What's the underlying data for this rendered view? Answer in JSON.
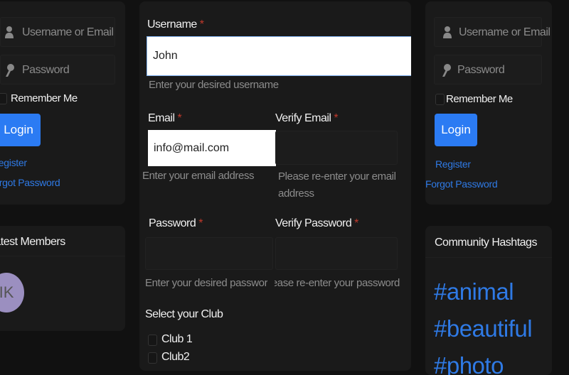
{
  "login_widget": {
    "username_placeholder": "Username or Email",
    "password_placeholder": "Password",
    "remember_label": "Remember Me",
    "login_button": "Login",
    "register_link": "Register",
    "forgot_link": "Forgot Password"
  },
  "latest_members": {
    "title": "Latest Members",
    "members": [
      {
        "initials": "IK"
      }
    ]
  },
  "registration": {
    "username_label": "Username",
    "username_value": "John",
    "username_help": "Enter your desired username",
    "email_label": "Email",
    "email_value": "info@mail.com",
    "email_help": "Enter your email address",
    "verify_email_label": "Verify Email",
    "verify_email_help": "Please re-enter your email address",
    "password_label": "Password",
    "password_help": "Enter your desired password",
    "verify_password_label": "Verify Password",
    "verify_password_help": "Please re-enter your password",
    "required_mark": "*",
    "club_label": "Select your Club",
    "clubs": [
      "Club 1",
      "Club2"
    ]
  },
  "hashtags": {
    "title": "Community Hashtags",
    "tags": [
      "#animal",
      "#beautiful",
      "#photo"
    ]
  },
  "colors": {
    "accent": "#2b7bf3",
    "required": "#c0392b",
    "avatar": "#9b8fc0"
  }
}
